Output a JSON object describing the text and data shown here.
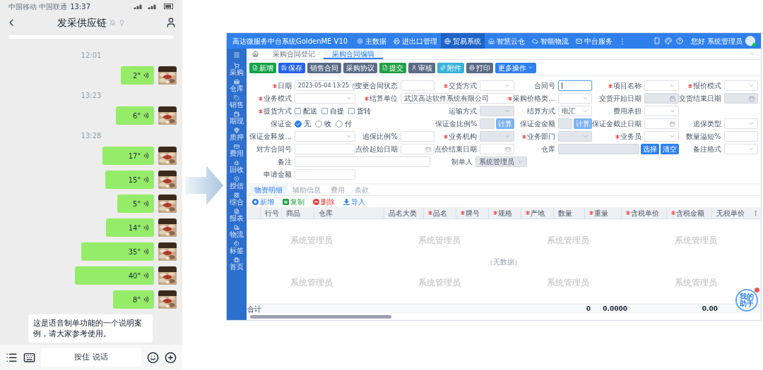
{
  "phone": {
    "status": {
      "carriers": "中国移动 中国联通",
      "time": "13:37"
    },
    "title": "发采供应链",
    "messages": [
      {
        "kind": "time",
        "text": "12:01"
      },
      {
        "kind": "voice",
        "duration": "2\""
      },
      {
        "kind": "time",
        "text": "13:23"
      },
      {
        "kind": "voice",
        "duration": "6\""
      },
      {
        "kind": "time",
        "text": "13:28"
      },
      {
        "kind": "voice",
        "duration": "17\""
      },
      {
        "kind": "voice",
        "duration": "15\""
      },
      {
        "kind": "voice",
        "duration": "5\""
      },
      {
        "kind": "voice",
        "duration": "14\""
      },
      {
        "kind": "voice",
        "duration": "35\""
      },
      {
        "kind": "voice",
        "duration": "40\""
      },
      {
        "kind": "voice",
        "duration": "8\""
      },
      {
        "kind": "text",
        "text": "这是语音制单功能的一个说明案例，请大家参考使用。"
      }
    ],
    "hold_to_talk": "按住 说话"
  },
  "app": {
    "title": "高达微服务中台系统GoldenME V10",
    "nav": [
      {
        "label": "主数据",
        "selected": false
      },
      {
        "label": "进出口管理",
        "selected": false
      },
      {
        "label": "贸易系统",
        "selected": true
      },
      {
        "label": "智慧云仓",
        "selected": false
      },
      {
        "label": "智能物流",
        "selected": false
      },
      {
        "label": "中台服务",
        "selected": false
      }
    ],
    "nav_more": "⋮",
    "greeting": "您好 系统管理员",
    "sidebar": [
      "采购",
      "仓库",
      "销售",
      "期现",
      "质押",
      "费用",
      "回收",
      "授信",
      "综合",
      "报表",
      "物流",
      "标签",
      "首页"
    ],
    "tabs": [
      {
        "label": "采购合同登记",
        "selected": false
      },
      {
        "label": "采购合同编辑",
        "selected": true
      }
    ],
    "toolbar": [
      {
        "label": "新增",
        "color": "#16a34a"
      },
      {
        "label": "保存",
        "color": "#2563eb"
      },
      {
        "label": "销售合同",
        "color": "#5b6b86"
      },
      {
        "label": "采购协议",
        "color": "#5b6b86"
      },
      {
        "label": "提交",
        "color": "#22a045"
      },
      {
        "label": "审核",
        "color": "#5b6b86"
      },
      {
        "label": "附件",
        "color": "#38b2d8"
      },
      {
        "label": "打印",
        "color": "#5b6b86"
      },
      {
        "label": "更多操作",
        "color": "#2f80ed"
      }
    ],
    "form": [
      [
        {
          "label": "日期",
          "required": true,
          "kind": "date",
          "value": "2023-05-04 13:25",
          "disabled": false
        },
        {
          "label": "变更合同状态",
          "required": false,
          "kind": "input",
          "disabled": false
        },
        {
          "label": "交货方式",
          "required": true,
          "kind": "select",
          "disabled": false
        },
        {
          "label": "合同号",
          "required": false,
          "kind": "input",
          "disabled": false,
          "focused": true
        },
        {
          "label": "项目名称",
          "required": true,
          "kind": "select",
          "disabled": false
        },
        {
          "label": "报价模式",
          "required": true,
          "kind": "select",
          "disabled": false
        }
      ],
      [
        {
          "label": "业务模式",
          "required": true,
          "kind": "select",
          "disabled": false
        },
        {
          "label": "结算单位",
          "required": true,
          "kind": "wide-select",
          "value": "武汉高达软件系统有限公司",
          "disabled": false
        },
        {
          "label": "采购价格类...",
          "required": true,
          "kind": "select",
          "disabled": false
        },
        {
          "label": "交货开始日期",
          "required": false,
          "kind": "date",
          "disabled": true
        },
        {
          "label": "交货结束日期",
          "required": false,
          "kind": "date",
          "disabled": true
        }
      ],
      [
        {
          "label": "提货方式",
          "required": true,
          "kind": "checks",
          "options": [
            {
              "label": "配送",
              "checked": false
            },
            {
              "label": "自提",
              "checked": false
            },
            {
              "label": "货转",
              "checked": false
            }
          ]
        },
        {
          "label": "运输方式",
          "required": false,
          "kind": "select",
          "disabled": true
        },
        {
          "label": "结算方式",
          "required": false,
          "kind": "select",
          "value": "电汇",
          "disabled": false
        },
        {
          "label": "费用承担",
          "required": false,
          "kind": "select",
          "disabled": false
        }
      ],
      [
        {
          "label": "保证金",
          "required": false,
          "kind": "radios",
          "options": [
            {
              "label": "无",
              "selected": true
            },
            {
              "label": "收",
              "selected": false
            },
            {
              "label": "付",
              "selected": false
            }
          ]
        },
        {
          "label": "保证金比例%",
          "required": false,
          "kind": "calc",
          "button": "计算",
          "disabled": true
        },
        {
          "label": "保证金金额",
          "required": false,
          "kind": "calc",
          "button": "计算",
          "disabled": true
        },
        {
          "label": "保证金截止日期",
          "required": false,
          "kind": "date",
          "disabled": false
        },
        {
          "label": "追保类型",
          "required": false,
          "kind": "select",
          "disabled": false
        }
      ],
      [
        {
          "label": "保证金释放...",
          "required": false,
          "kind": "select",
          "disabled": false
        },
        {
          "label": "追保比例%",
          "required": false,
          "kind": "input",
          "disabled": false
        },
        {
          "label": "业务机构",
          "required": true,
          "kind": "select",
          "disabled": true
        },
        {
          "label": "业务部门",
          "required": true,
          "kind": "select",
          "disabled": true
        },
        {
          "label": "业务员",
          "required": true,
          "kind": "select",
          "disabled": false
        },
        {
          "label": "数量溢短%",
          "required": false,
          "kind": "input",
          "disabled": false
        }
      ],
      [
        {
          "label": "对方合同号",
          "required": false,
          "kind": "input",
          "disabled": false
        },
        {
          "label": "点价起始日期",
          "required": false,
          "kind": "date",
          "disabled": false
        },
        {
          "label": "点价结束日期",
          "required": false,
          "kind": "date",
          "disabled": false
        },
        {
          "label": "仓库",
          "required": false,
          "kind": "picker",
          "buttons": [
            "选择",
            "清空"
          ],
          "disabled": true
        },
        {
          "label": "备注格式",
          "required": false,
          "kind": "select",
          "disabled": false
        }
      ],
      [
        {
          "label": "备注",
          "required": false,
          "kind": "wide-input",
          "disabled": false
        },
        {
          "label": "制单人",
          "required": false,
          "kind": "select",
          "value": "系统管理员",
          "disabled": true
        }
      ],
      [
        {
          "label": "申请金额",
          "required": false,
          "kind": "input",
          "disabled": false
        }
      ]
    ],
    "detail_tabs": [
      {
        "label": "物资明细",
        "selected": true
      },
      {
        "label": "辅助信息",
        "selected": false
      },
      {
        "label": "费用",
        "selected": false
      },
      {
        "label": "条款",
        "selected": false
      }
    ],
    "detail_actions": [
      {
        "label": "新增",
        "color": "#2f80ed"
      },
      {
        "label": "复制",
        "color": "#22a045"
      },
      {
        "label": "删除",
        "color": "#e53e3e"
      },
      {
        "label": "导入",
        "color": "#2f80ed"
      }
    ],
    "columns": [
      {
        "label": "行号",
        "required": false
      },
      {
        "label": "商品",
        "required": false
      },
      {
        "label": "仓库",
        "required": false
      },
      {
        "label": "品名大类",
        "required": false
      },
      {
        "label": "品名",
        "required": true
      },
      {
        "label": "牌号",
        "required": true
      },
      {
        "label": "规格",
        "required": true
      },
      {
        "label": "产地",
        "required": true
      },
      {
        "label": "数量",
        "required": false,
        "total": "0"
      },
      {
        "label": "重量",
        "required": true,
        "total": "0.0000"
      },
      {
        "label": "含税单价",
        "required": true
      },
      {
        "label": "含税金额",
        "required": true,
        "total": "0.00"
      },
      {
        "label": "无税单价",
        "required": false
      }
    ],
    "watermarks": [
      "系统管理员",
      "系统管理员",
      "系统管理员",
      "系统管理员",
      "系统管理员",
      "系统管理员",
      "系统管理员",
      "系统管理员"
    ],
    "empty_text": "（无数据）",
    "footer_label": "合计",
    "assistant": "我的助手"
  }
}
